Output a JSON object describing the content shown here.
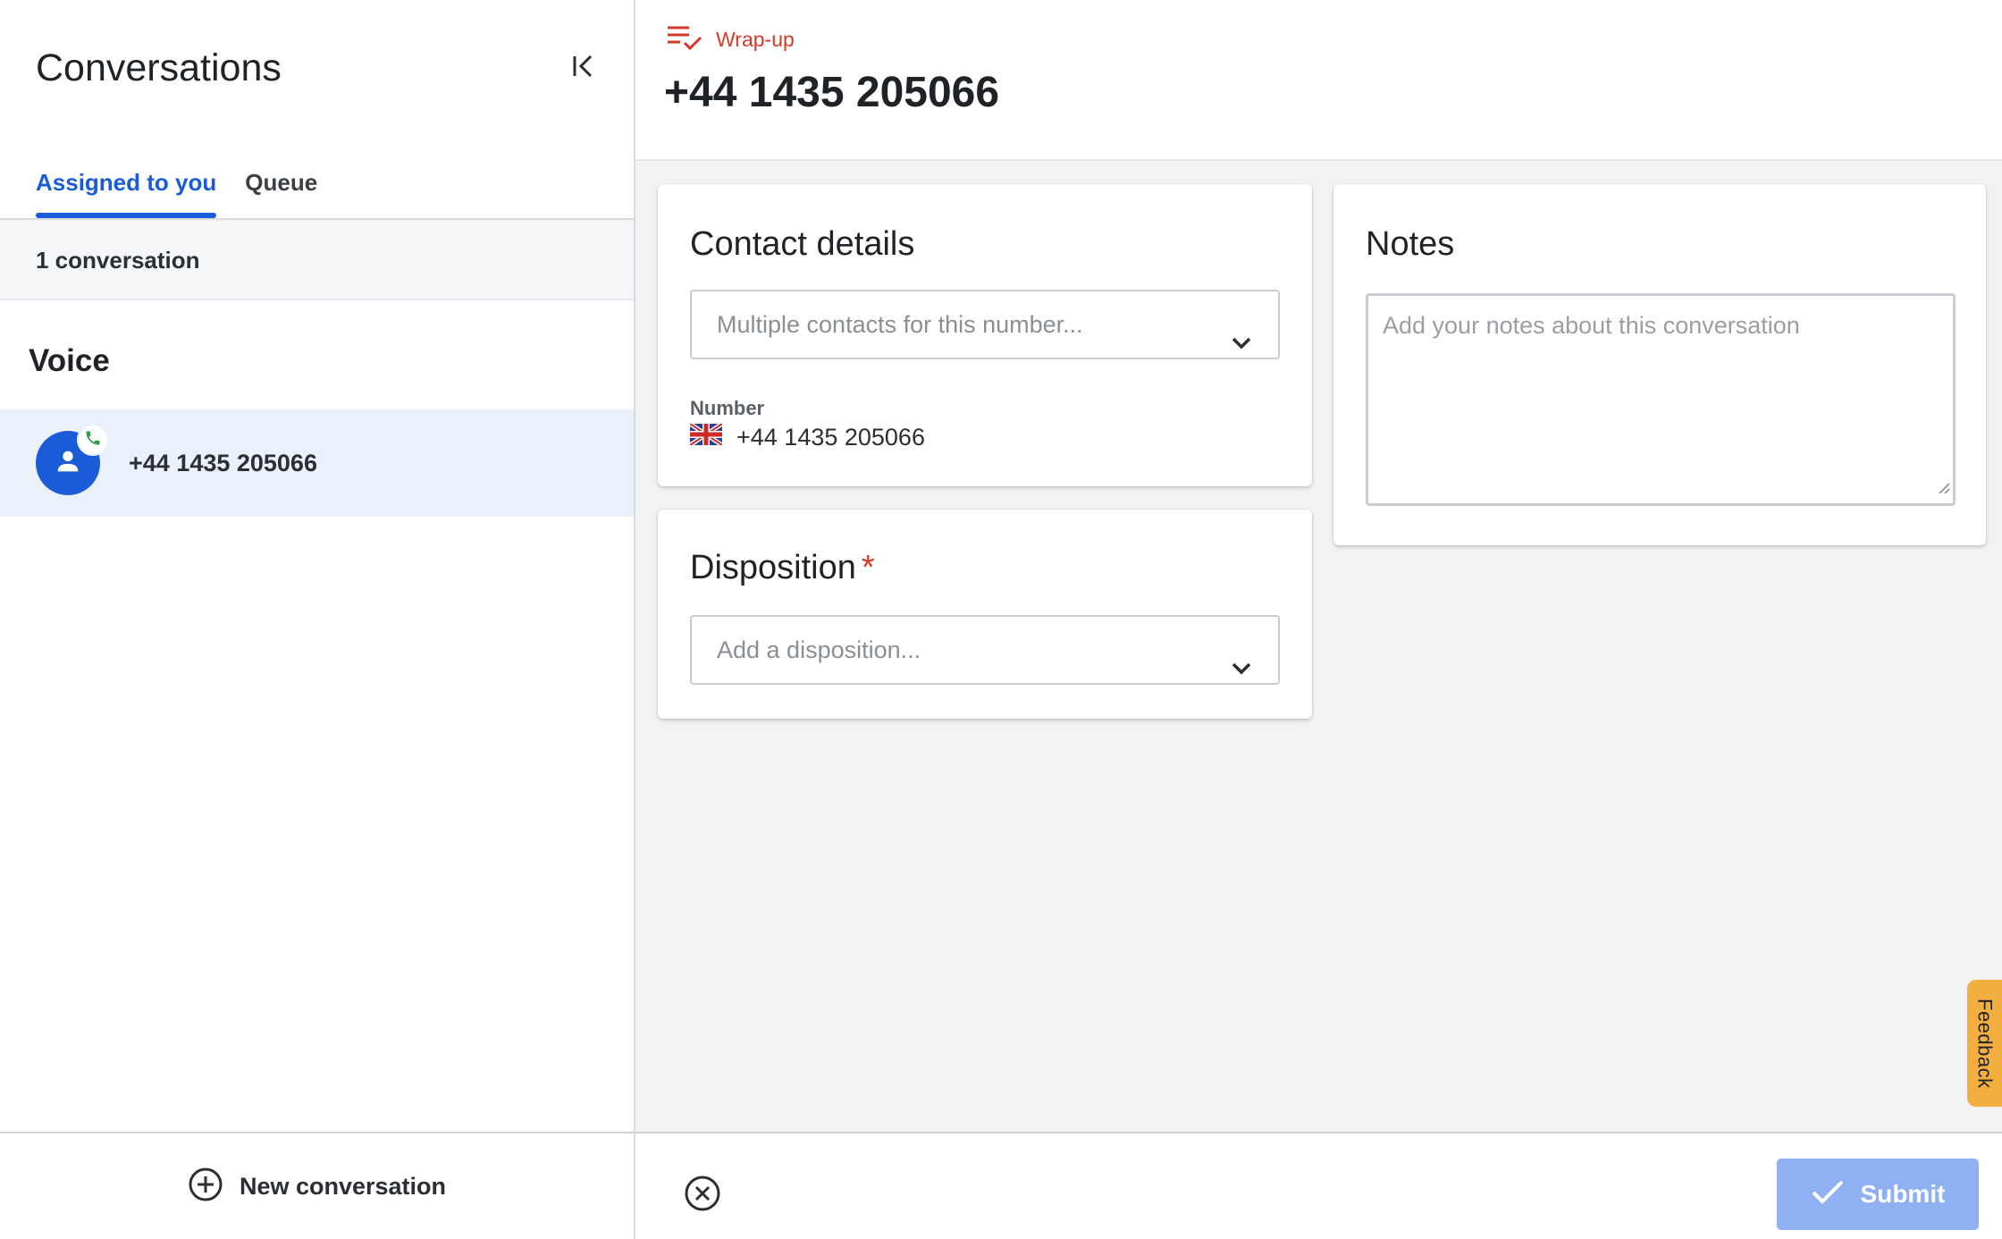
{
  "sidebar": {
    "title": "Conversations",
    "collapse_icon": "collapse-left-icon",
    "tabs": [
      {
        "label": "Assigned to you",
        "active": true
      },
      {
        "label": "Queue",
        "active": false
      }
    ],
    "count_text": "1 conversation",
    "section_title": "Voice",
    "conversations": [
      {
        "label": "+44 1435 205066",
        "icon": "person-icon",
        "badge_icon": "phone-icon",
        "selected": true
      }
    ],
    "new_conversation_label": "New conversation",
    "new_conversation_icon": "plus-circle-icon"
  },
  "main": {
    "status": {
      "icon": "wrap-up-icon",
      "label": "Wrap-up",
      "color": "#d23a2a"
    },
    "title": "+44 1435 205066",
    "contact_details": {
      "title": "Contact details",
      "select_placeholder": "Multiple contacts for this number...",
      "number_label": "Number",
      "number_value": "+44 1435 205066",
      "flag_icon": "uk-flag-icon"
    },
    "disposition": {
      "title": "Disposition",
      "required_marker": "*",
      "select_placeholder": "Add a disposition..."
    },
    "notes": {
      "title": "Notes",
      "placeholder": "Add your notes about this conversation"
    },
    "feedback_label": "Feedback",
    "submit_label": "Submit",
    "close_icon": "close-circle-icon"
  },
  "colors": {
    "accent": "#1a5bd8",
    "selected_row": "#eaf1fb",
    "submit_disabled": "#8fb0f3",
    "feedback": "#f2ae3e",
    "required": "#d23a2a"
  }
}
